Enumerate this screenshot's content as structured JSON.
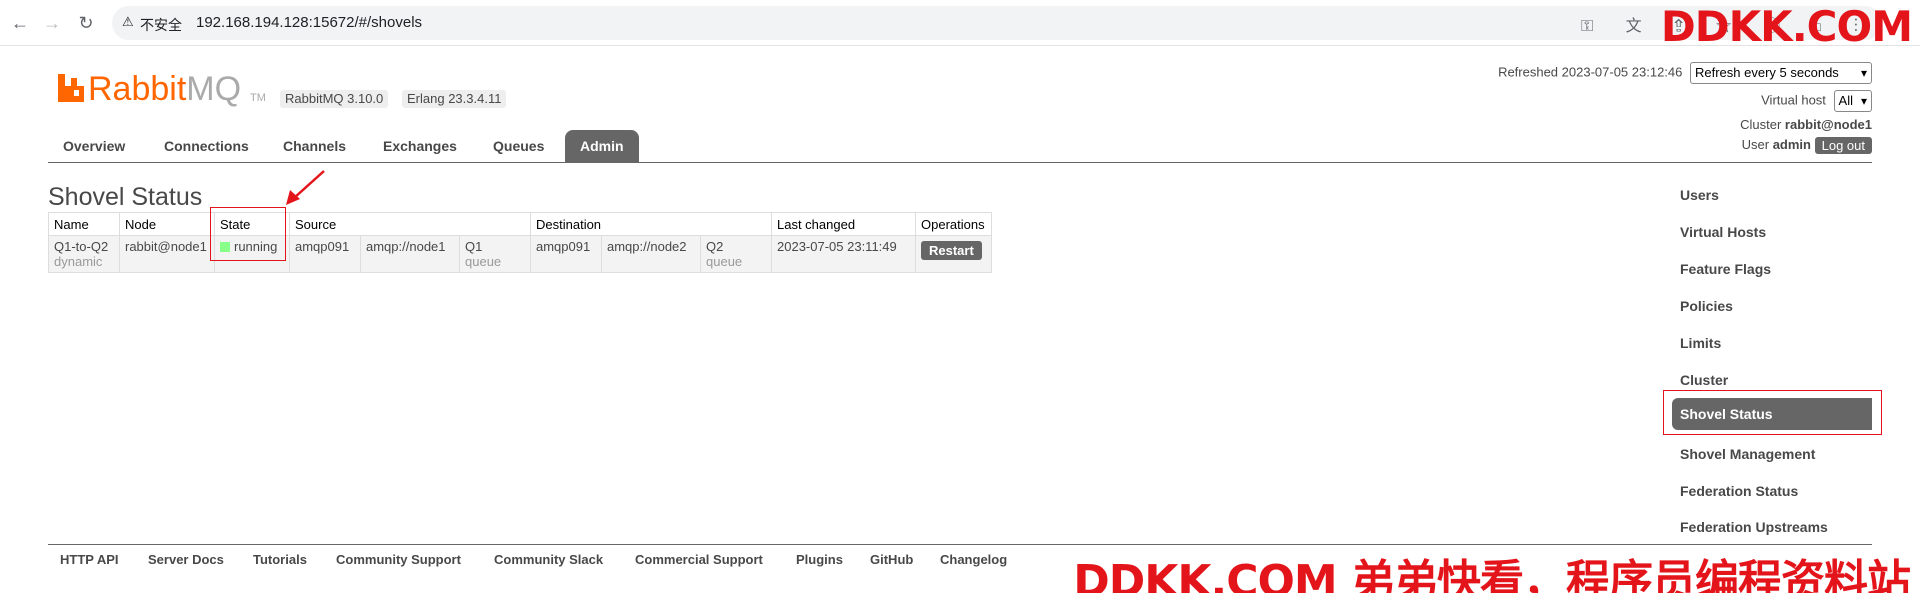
{
  "browser": {
    "security_label": "不安全",
    "url": "192.168.194.128:15672/#/shovels"
  },
  "watermark": {
    "top": "DDKK.COM",
    "bottom": "DDKK.COM 弟弟快看，程序员编程资料站"
  },
  "header": {
    "logo_rabbit": "Rabbit",
    "logo_mq": "MQ",
    "logo_tm": "TM",
    "rabbitmq_version": "RabbitMQ 3.10.0",
    "erlang_version": "Erlang 23.3.4.11",
    "refreshed_label": "Refreshed 2023-07-05 23:12:46",
    "refresh_select": "Refresh every 5 seconds",
    "virtual_host_label": "Virtual host",
    "virtual_host_value": "All",
    "cluster_label": "Cluster",
    "cluster_value": "rabbit@node1",
    "user_label": "User",
    "user_value": "admin",
    "logout": "Log out"
  },
  "tabs": [
    {
      "label": "Overview"
    },
    {
      "label": "Connections"
    },
    {
      "label": "Channels"
    },
    {
      "label": "Exchanges"
    },
    {
      "label": "Queues"
    },
    {
      "label": "Admin",
      "active": true
    }
  ],
  "page_title": "Shovel Status",
  "table": {
    "headers": [
      "Name",
      "Node",
      "State",
      "Source",
      "Destination",
      "Last changed",
      "Operations"
    ],
    "rows": [
      {
        "name": "Q1-to-Q2",
        "type": "dynamic",
        "node": "rabbit@node1",
        "state": "running",
        "src_protocol": "amqp091",
        "src_uri": "amqp://node1",
        "src_queue": "Q1",
        "src_kind": "queue",
        "dest_protocol": "amqp091",
        "dest_uri": "amqp://node2",
        "dest_queue": "Q2",
        "dest_kind": "queue",
        "last_changed": "2023-07-05 23:11:49",
        "operation": "Restart"
      }
    ]
  },
  "admin_nav": [
    {
      "label": "Users"
    },
    {
      "label": "Virtual Hosts"
    },
    {
      "label": "Feature Flags"
    },
    {
      "label": "Policies"
    },
    {
      "label": "Limits"
    },
    {
      "label": "Cluster"
    },
    {
      "label": "Shovel Status",
      "active": true
    },
    {
      "label": "Shovel Management"
    },
    {
      "label": "Federation Status"
    },
    {
      "label": "Federation Upstreams"
    }
  ],
  "footer": [
    "HTTP API",
    "Server Docs",
    "Tutorials",
    "Community Support",
    "Community Slack",
    "Commercial Support",
    "Plugins",
    "GitHub",
    "Changelog"
  ],
  "colors": {
    "brand_orange": "#ff6600",
    "tab_active": "#666666",
    "annotation_red": "#e4141b",
    "running_green": "#88ff88"
  }
}
